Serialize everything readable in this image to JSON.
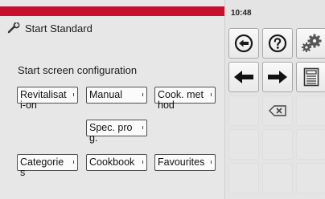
{
  "status": {
    "time": "10:48"
  },
  "header": {
    "title": "Start Standard",
    "icon": "wrench-icon"
  },
  "section": {
    "title": "Start screen configuration"
  },
  "options": [
    {
      "label": "Revitalisati-on"
    },
    {
      "label": "Manual"
    },
    {
      "label": "Cook. method"
    },
    {
      "label": "Spec. prog."
    },
    {
      "label": "Categories"
    },
    {
      "label": "Cookbook"
    },
    {
      "label": "Favourites"
    }
  ],
  "sidebar": {
    "buttons": [
      "back-circle-icon",
      "help-icon",
      "settings-gears-icon",
      "arrow-left-icon",
      "arrow-right-icon",
      "save-icon",
      "backspace-icon"
    ]
  },
  "colors": {
    "header_bar": "#c8102e",
    "background": "#e7e7e7",
    "sidebar": "#e4e4e4"
  }
}
